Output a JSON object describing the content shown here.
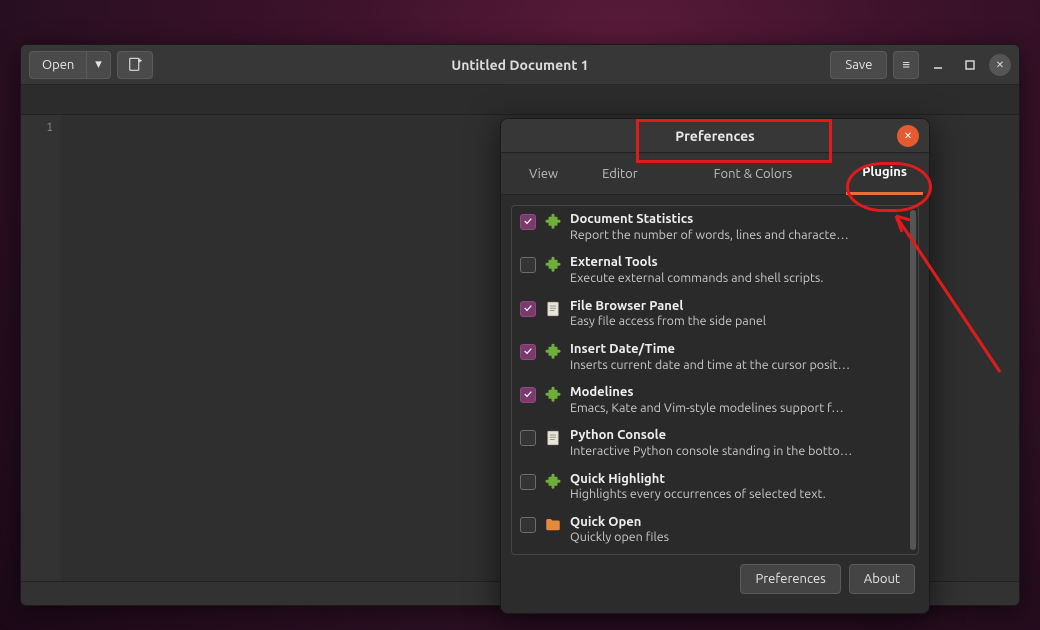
{
  "main": {
    "open_label": "Open",
    "title": "Untitled Document 1",
    "save_label": "Save",
    "gutter_first_line": "1"
  },
  "prefs": {
    "title": "Preferences",
    "tabs": {
      "view": "View",
      "editor": "Editor",
      "font_colors": "Font & Colors",
      "plugins": "Plugins"
    },
    "footer": {
      "preferences": "Preferences",
      "about": "About"
    },
    "plugins": [
      {
        "checked": true,
        "icon": "puzzle",
        "name": "Document Statistics",
        "desc": "Report the number of words, lines and characte…"
      },
      {
        "checked": false,
        "icon": "puzzle",
        "name": "External Tools",
        "desc": "Execute external commands and shell scripts."
      },
      {
        "checked": true,
        "icon": "doc",
        "name": "File Browser Panel",
        "desc": "Easy file access from the side panel"
      },
      {
        "checked": true,
        "icon": "puzzle",
        "name": "Insert Date/Time",
        "desc": "Inserts current date and time at the cursor posit…"
      },
      {
        "checked": true,
        "icon": "puzzle",
        "name": "Modelines",
        "desc": "Emacs, Kate and Vim-style modelines support f…"
      },
      {
        "checked": false,
        "icon": "doc",
        "name": "Python Console",
        "desc": "Interactive Python console standing in the botto…"
      },
      {
        "checked": false,
        "icon": "puzzle",
        "name": "Quick Highlight",
        "desc": "Highlights every occurrences of selected text."
      },
      {
        "checked": false,
        "icon": "folder",
        "name": "Quick Open",
        "desc": "Quickly open files"
      }
    ]
  }
}
